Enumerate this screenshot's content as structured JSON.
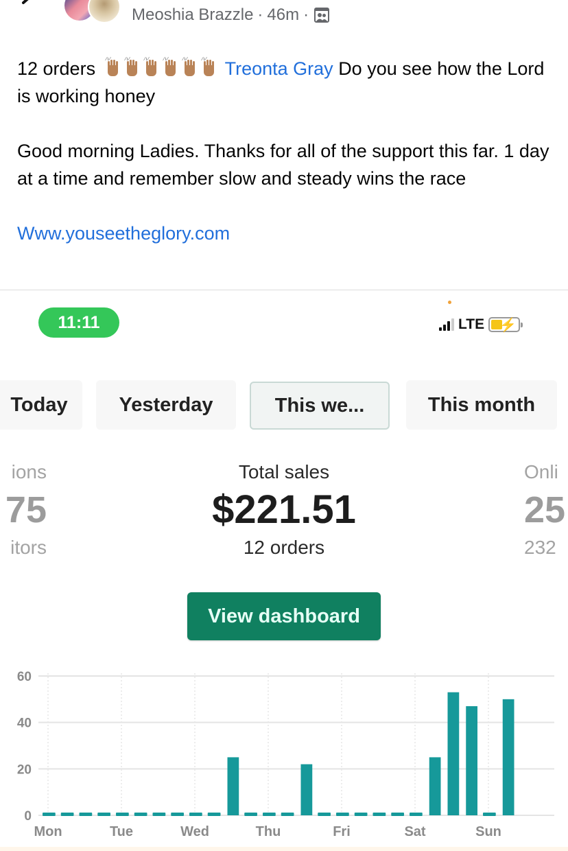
{
  "post": {
    "author": "Meoshia Brazzle",
    "separator": "·",
    "time_ago": "46m",
    "audience_icon": "group-icon",
    "back_icon": "back-arrow-icon",
    "text_line1_prefix": "12 orders",
    "emoji": "raising-hands-medium-skin-tone",
    "emoji_count": 6,
    "mention": "Treonta Gray",
    "text_line1_suffix": "Do you see how the Lord is working honey",
    "paragraph2": "Good morning Ladies. Thanks for all of the support this far. 1 day at a time and remember slow and steady wins the race",
    "link": "Www.youseetheglory.com"
  },
  "screenshot": {
    "status_bar": {
      "time": "11:11",
      "network": "LTE",
      "signal_icon": "signal-bars-icon",
      "battery_icon": "battery-charging-icon"
    },
    "tabs": [
      {
        "label": "Today",
        "active": false
      },
      {
        "label": "Yesterday",
        "active": false
      },
      {
        "label": "This we...",
        "active": true
      },
      {
        "label": "This month",
        "active": false
      }
    ],
    "metrics": {
      "left": {
        "label": "ions",
        "value": "75",
        "sub": "itors"
      },
      "center": {
        "label": "Total sales",
        "value": "$221.51",
        "sub": "12 orders"
      },
      "right": {
        "label": "Onli",
        "value": "25",
        "sub": "232"
      }
    },
    "view_dashboard_label": "View dashboard",
    "colors": {
      "accent_green": "#108060",
      "bar_teal": "#16999a",
      "time_pill": "#34c759",
      "link_blue": "#216fdb"
    }
  },
  "chart_data": {
    "type": "bar",
    "title": "",
    "xlabel": "",
    "ylabel": "",
    "ylim": [
      0,
      60
    ],
    "yticks": [
      0,
      20,
      40,
      60
    ],
    "grid": true,
    "legend": "none",
    "categories": [
      "Mon",
      "Tue",
      "Wed",
      "Thu",
      "Fri",
      "Sat",
      "Sun"
    ],
    "buckets_per_category": 4,
    "values": [
      0,
      0,
      0,
      0,
      0,
      0,
      0,
      0,
      0,
      0,
      25,
      0,
      0,
      0,
      22,
      0,
      0,
      0,
      0,
      0,
      0,
      25,
      53,
      47,
      0,
      50
    ]
  }
}
